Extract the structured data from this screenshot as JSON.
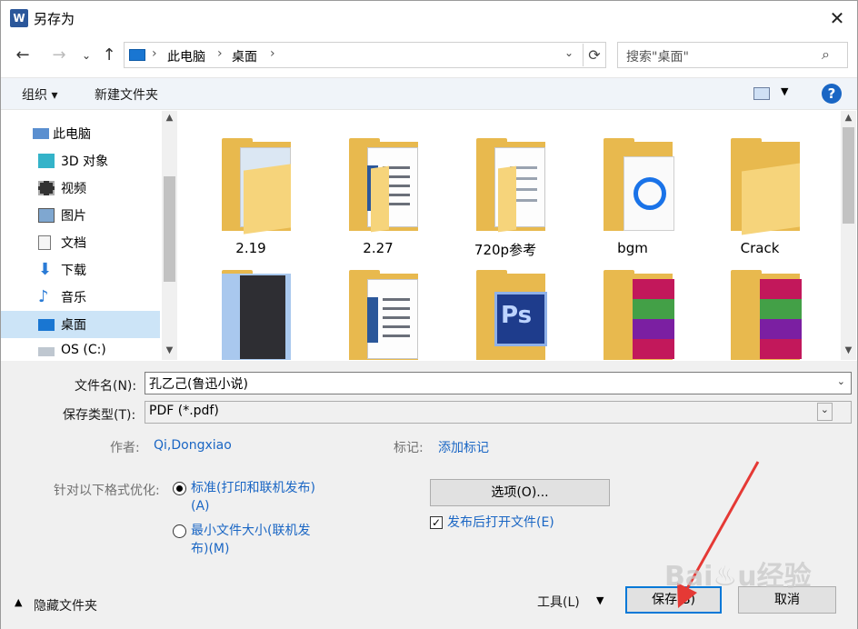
{
  "window": {
    "title": "另存为",
    "app_icon": "word-icon",
    "close": "✕"
  },
  "nav": {
    "back": "←",
    "forward": "→",
    "recent": "⌄",
    "up": "↑",
    "breadcrumbs": [
      "此电脑",
      "桌面"
    ],
    "refresh": "⟳",
    "search_placeholder": "搜索\"桌面\""
  },
  "toolbar": {
    "organize": "组织 ▾",
    "new_folder": "新建文件夹",
    "help": "?"
  },
  "sidebar": {
    "items": [
      {
        "label": "此电脑",
        "icon": "computer-icon"
      },
      {
        "label": "3D 对象",
        "icon": "cube-icon"
      },
      {
        "label": "视频",
        "icon": "film-icon"
      },
      {
        "label": "图片",
        "icon": "picture-icon"
      },
      {
        "label": "文档",
        "icon": "document-icon"
      },
      {
        "label": "下载",
        "icon": "download-icon"
      },
      {
        "label": "音乐",
        "icon": "music-icon"
      },
      {
        "label": "桌面",
        "icon": "desktop-icon",
        "selected": true
      },
      {
        "label": "OS (C:)",
        "icon": "drive-icon"
      }
    ]
  },
  "files": {
    "row1": [
      {
        "label": "2.19",
        "kind": "folder-photo"
      },
      {
        "label": "2.27",
        "kind": "folder-doc"
      },
      {
        "label": "720p参考",
        "kind": "folder-doc"
      },
      {
        "label": "bgm",
        "kind": "folder-app"
      },
      {
        "label": "Crack",
        "kind": "folder"
      }
    ],
    "row2": [
      {
        "label": "",
        "kind": "folder-dark"
      },
      {
        "label": "",
        "kind": "folder-doc"
      },
      {
        "label": "",
        "kind": "folder-ps"
      },
      {
        "label": "",
        "kind": "folder-rar"
      },
      {
        "label": "",
        "kind": "folder-rar"
      }
    ]
  },
  "form": {
    "filename_label": "文件名(N):",
    "filename_value": "孔乙己(鲁迅小说)",
    "type_label": "保存类型(T):",
    "type_value": "PDF (*.pdf)",
    "author_label": "作者:",
    "author_value": "Qi,Dongxiao",
    "tags_label": "标记:",
    "tags_value": "添加标记",
    "optimize_label": "针对以下格式优化:",
    "opt_standard_1": "标准(打印和联机发布)",
    "opt_standard_2": "(A)",
    "opt_min_1": "最小文件大小(联机发",
    "opt_min_2": "布)(M)",
    "options_button": "选项(O)...",
    "open_after": "发布后打开文件(E)",
    "open_after_checked": "✓"
  },
  "footer": {
    "hide_folders": "隐藏文件夹",
    "tools": "工具(L)",
    "save": "保存(S)",
    "cancel": "取消"
  },
  "colors": {
    "accent": "#0078d7",
    "link": "#1a66c4",
    "annotation": "#e53935"
  }
}
